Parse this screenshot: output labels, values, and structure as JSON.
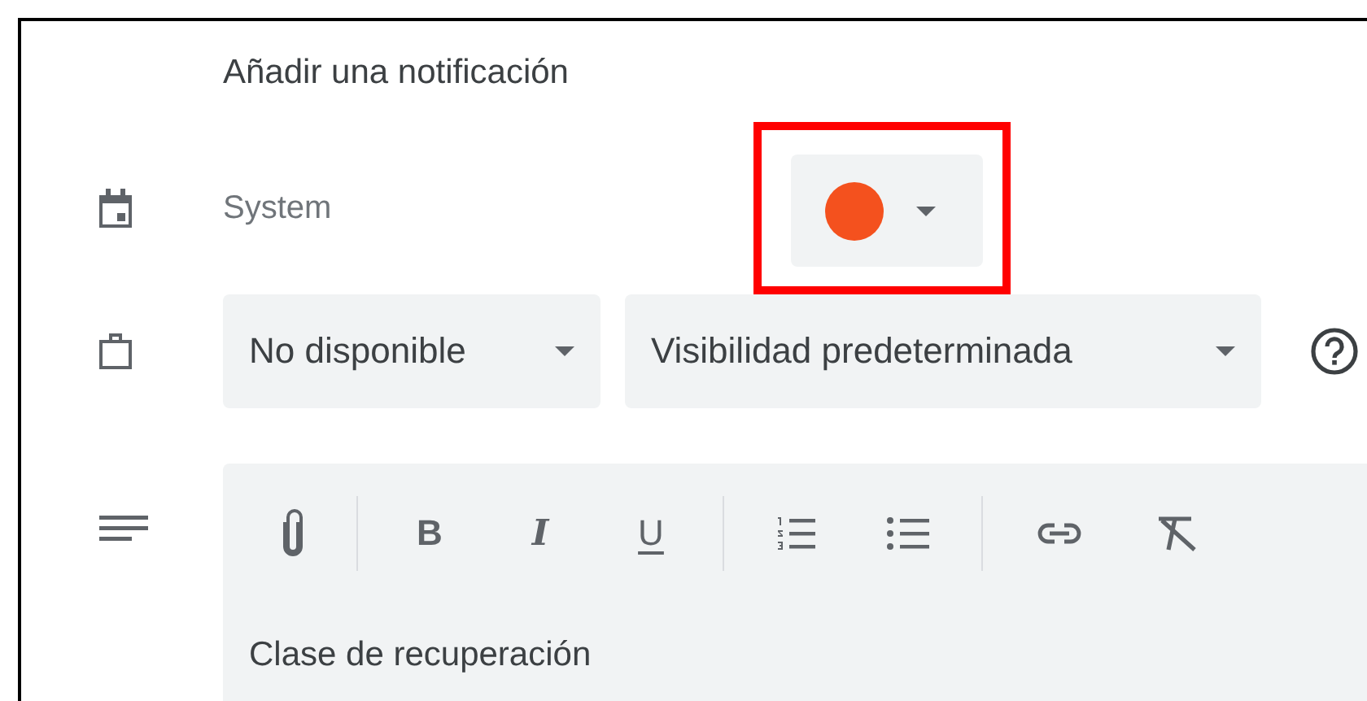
{
  "title": "Añadir una notificación",
  "calendar": {
    "name": "System",
    "color": "#f4511e",
    "highlighted": true
  },
  "dropdowns": [
    {
      "label": "No disponible"
    },
    {
      "label": "Visibilidad predeterminada"
    }
  ],
  "editor": {
    "toolbar": [
      {
        "kind": "attach"
      },
      {
        "kind": "divider"
      },
      {
        "kind": "bold",
        "label": "B"
      },
      {
        "kind": "italic",
        "label": "I"
      },
      {
        "kind": "underline",
        "label": "U"
      },
      {
        "kind": "divider"
      },
      {
        "kind": "numbered"
      },
      {
        "kind": "bulleted"
      },
      {
        "kind": "divider"
      },
      {
        "kind": "link"
      },
      {
        "kind": "clear"
      }
    ],
    "text": "Clase de recuperación"
  }
}
